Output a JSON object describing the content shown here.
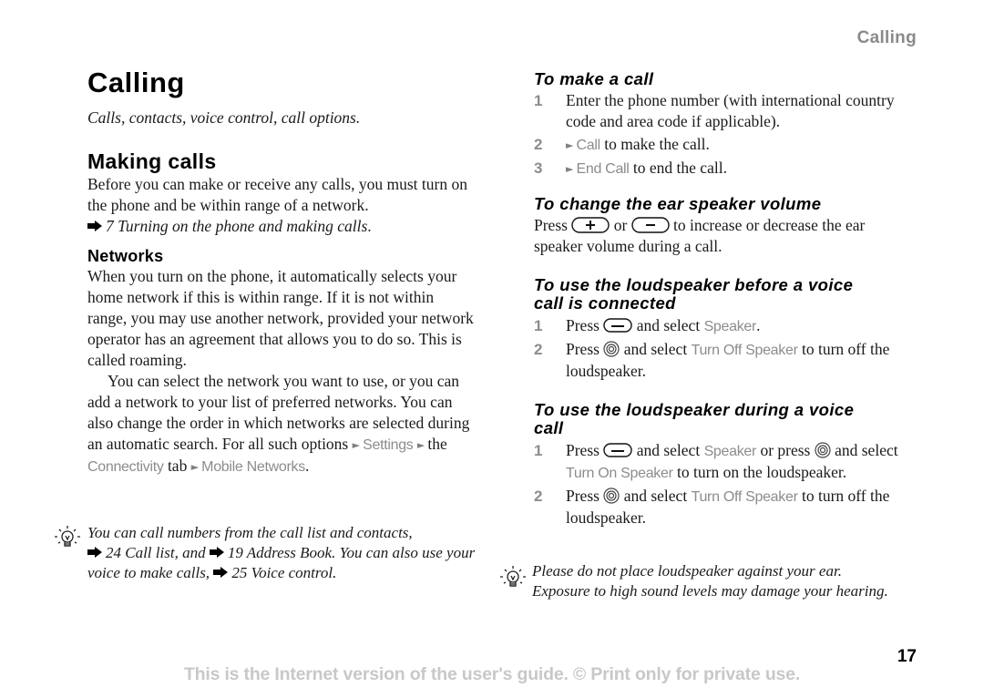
{
  "header": {
    "running_title": "Calling"
  },
  "left": {
    "chapter_title": "Calling",
    "chapter_subtitle": "Calls, contacts, voice control, call options.",
    "section_title": "Making calls",
    "intro": "Before you can make or receive any calls, you must turn on the phone and be within range of a network.",
    "intro_ref": "7 Turning on the phone and making calls",
    "intro_ref_end": ".",
    "networks_title": "Networks",
    "networks_p1": "When you turn on the phone, it automatically selects your home network if this is within range. If it is not within range, you may use another network, provided your network operator has an agreement that allows you to do so. This is called roaming.",
    "networks_p2_text": "You can select the network you want to use, or you can add a network to your list of preferred networks. You can also change the order in which networks are selected during an automatic search. For all such options",
    "menu_settings": "Settings",
    "the_text": "the",
    "menu_connectivity": "Connectivity",
    "tab_text": "tab",
    "menu_mobile_networks": "Mobile Networks",
    "period": ".",
    "tip": {
      "text1": "You can call numbers from the call list and contacts,",
      "ref1": "24 Call list, and",
      "ref2": "19 Address Book. You can also use your voice to make calls,",
      "ref3": "25 Voice control."
    }
  },
  "right": {
    "make_call": {
      "title": "To make a call",
      "steps": [
        {
          "num": "1",
          "text": "Enter the phone number (with international country code and area code if applicable)."
        },
        {
          "num": "2",
          "menu": "Call",
          "text": " to make the call."
        },
        {
          "num": "3",
          "menu": "End Call",
          "text": " to end the call."
        }
      ]
    },
    "volume": {
      "title": "To change the ear speaker volume",
      "press": "Press",
      "or": "or",
      "rest": "to increase or decrease the ear speaker volume during a call."
    },
    "loudspeaker_before": {
      "title": "To use the loudspeaker before a voice call is connected",
      "step1_num": "1",
      "step1_press": "Press",
      "step1_mid": "and select",
      "step1_menu": "Speaker",
      "step1_end": ".",
      "step2_num": "2",
      "step2_press": "Press",
      "step2_mid": "and select",
      "step2_menu": "Turn Off Speaker",
      "step2_end": "to turn off the loudspeaker."
    },
    "loudspeaker_during": {
      "title": "To use the loudspeaker during a voice call",
      "step1_num": "1",
      "step1_press": "Press",
      "step1_mid": "and select",
      "step1_menu": "Speaker",
      "step1_or": "or press",
      "step1_and": "and select",
      "step1_menu2": "Turn On Speaker",
      "step1_end": "to turn on the loudspeaker.",
      "step2_num": "2",
      "step2_press": "Press",
      "step2_mid": "and select",
      "step2_menu": "Turn Off Speaker",
      "step2_end": "to turn off the loudspeaker."
    },
    "tip": "Please do not place loudspeaker against your ear. Exposure to high sound levels may damage your hearing."
  },
  "footer": {
    "page_number": "17",
    "notice": "This is the Internet version of the user's guide. © Print only for private use."
  },
  "colors": {
    "menu_gray": "#8c8c8c",
    "footer_gray": "#c8c8c8",
    "text": "#1a1a1a"
  }
}
